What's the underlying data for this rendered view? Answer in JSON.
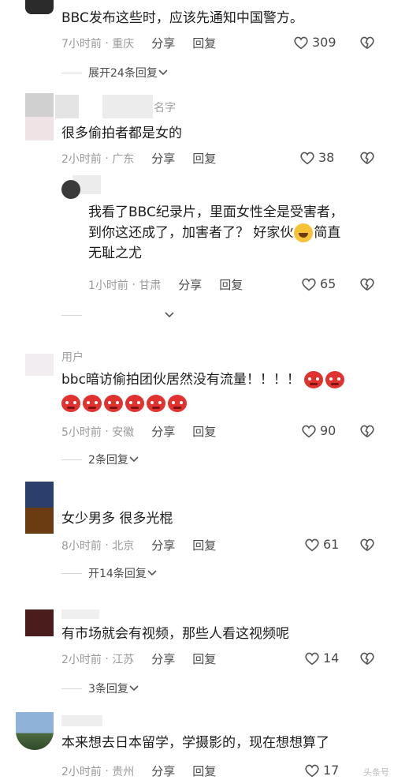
{
  "actions": {
    "reply_label": "分享",
    "reply2_label": "回复"
  },
  "comments": [
    {
      "text": "BBC发布这些时，应该先通知中国警方。",
      "time": "7小时前",
      "location": "重庆",
      "likes": "309",
      "expand": "展开24条回复"
    },
    {
      "username": "名字",
      "text": "很多偷拍者都是女的",
      "time": "2小时前",
      "location": "广东",
      "likes": "38"
    },
    {
      "text_lines": [
        "我看了BBC纪录片，里面女性全是受害者，",
        "到你这还成了，加害者了？ 好家伙",
        "简直",
        "无耻之尤"
      ],
      "time": "1小时前",
      "location": "甘肃",
      "likes": "65"
    },
    {
      "username": "用户",
      "text": "bbc暗访偷拍团伙居然没有流量！！！！",
      "time": "5小时前",
      "location": "安徽",
      "likes": "90",
      "expand": "2条回复"
    },
    {
      "text": "女少男多 很多光棍",
      "time": "8小时前",
      "location": "北京",
      "likes": "61",
      "expand": "开14条回复"
    },
    {
      "text": "有市场就会有视频，那些人看这视频呢",
      "time": "2小时前",
      "location": "江苏",
      "likes": "14",
      "expand": "3条回复"
    },
    {
      "text": "本来想去日本留学，学摄影的，现在想想算了",
      "time": "2小时前",
      "location": "贵州",
      "likes": "17"
    }
  ],
  "colors": {
    "meta": "#9a9a9a",
    "text": "#1c1c1c",
    "angry": "#e0322f"
  },
  "watermark": "头条号"
}
